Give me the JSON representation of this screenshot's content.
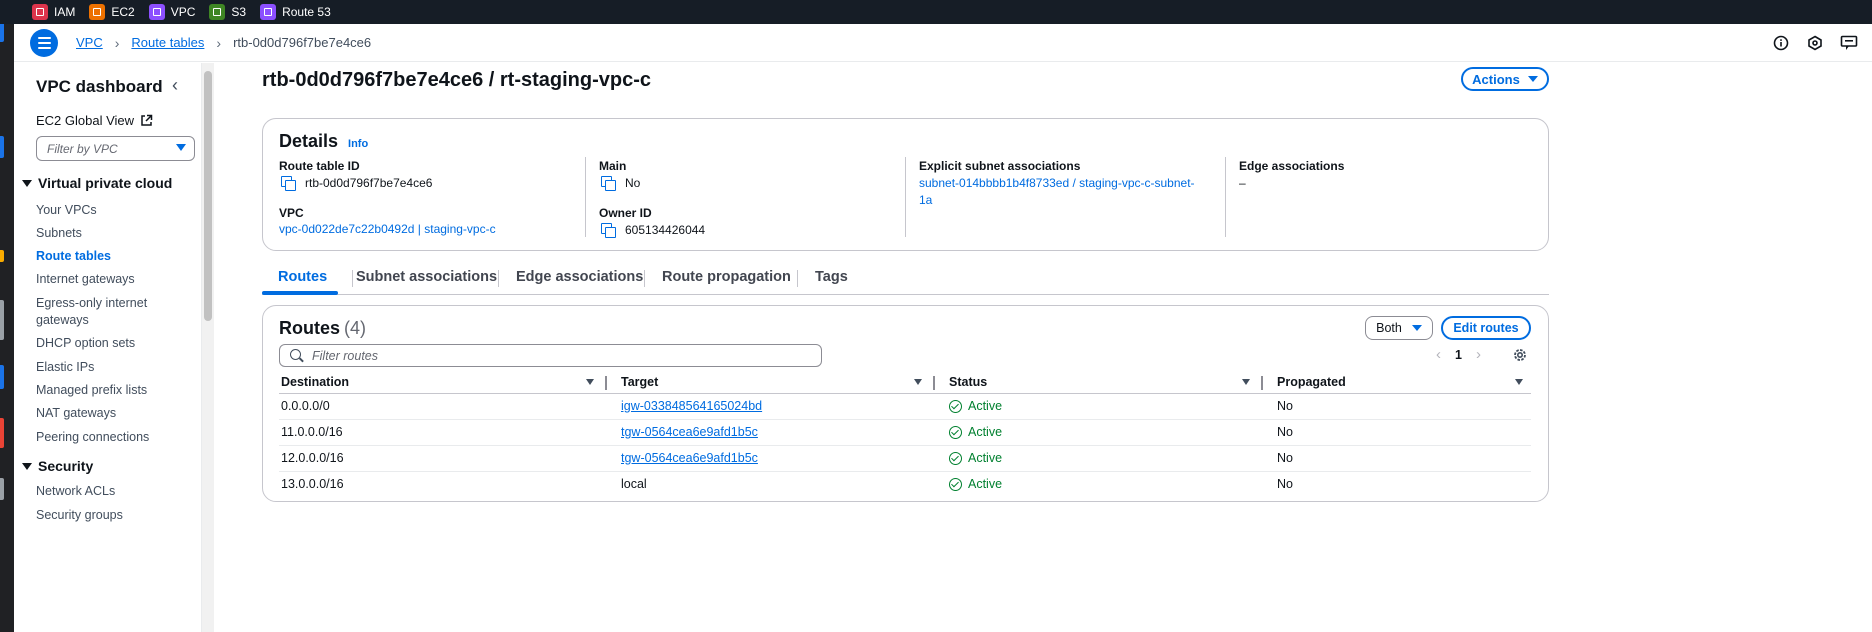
{
  "favorites": [
    {
      "label": "IAM",
      "color": "#dd344c"
    },
    {
      "label": "EC2",
      "color": "#ed7100"
    },
    {
      "label": "VPC",
      "color": "#8c4fff"
    },
    {
      "label": "S3",
      "color": "#3f8624"
    },
    {
      "label": "Route 53",
      "color": "#8c4fff"
    }
  ],
  "breadcrumb": {
    "root": "VPC",
    "parent": "Route tables",
    "current": "rtb-0d0d796f7be7e4ce6"
  },
  "sidebar": {
    "title": "VPC dashboard",
    "global_view": "EC2 Global View",
    "filter_placeholder": "Filter by VPC",
    "section_vpc": "Virtual private cloud",
    "vpc_items": [
      "Your VPCs",
      "Subnets",
      "Route tables",
      "Internet gateways",
      "Egress-only internet gateways",
      "DHCP option sets",
      "Elastic IPs",
      "Managed prefix lists",
      "NAT gateways",
      "Peering connections"
    ],
    "section_security": "Security",
    "security_items": [
      "Network ACLs",
      "Security groups"
    ]
  },
  "page": {
    "title": "rtb-0d0d796f7be7e4ce6 / rt-staging-vpc-c",
    "actions_label": "Actions"
  },
  "details": {
    "heading": "Details",
    "info": "Info",
    "route_table_id_label": "Route table ID",
    "route_table_id": "rtb-0d0d796f7be7e4ce6",
    "main_label": "Main",
    "main": "No",
    "explicit_label": "Explicit subnet associations",
    "explicit_line1": "subnet-014bbbb1b4f8733ed / staging-vpc-c-subnet-",
    "explicit_line2": "1a",
    "edge_label": "Edge associations",
    "edge": "–",
    "vpc_label": "VPC",
    "vpc": "vpc-0d022de7c22b0492d | staging-vpc-c",
    "owner_label": "Owner ID",
    "owner": "605134426044"
  },
  "tabs": [
    "Routes",
    "Subnet associations",
    "Edge associations",
    "Route propagation",
    "Tags"
  ],
  "routes": {
    "heading": "Routes",
    "count": "(4)",
    "both_label": "Both",
    "edit_label": "Edit routes",
    "filter_placeholder": "Filter routes",
    "page": "1",
    "columns": [
      "Destination",
      "Target",
      "Status",
      "Propagated"
    ],
    "rows": [
      {
        "destination": "0.0.0.0/0",
        "target": "igw-033848564165024bd",
        "target_link": true,
        "status": "Active",
        "propagated": "No"
      },
      {
        "destination": "11.0.0.0/16",
        "target": "tgw-0564cea6e9afd1b5c",
        "target_link": true,
        "status": "Active",
        "propagated": "No"
      },
      {
        "destination": "12.0.0.0/16",
        "target": "tgw-0564cea6e9afd1b5c",
        "target_link": true,
        "status": "Active",
        "propagated": "No"
      },
      {
        "destination": "13.0.0.0/16",
        "target": "local",
        "target_link": false,
        "status": "Active",
        "propagated": "No"
      }
    ]
  }
}
